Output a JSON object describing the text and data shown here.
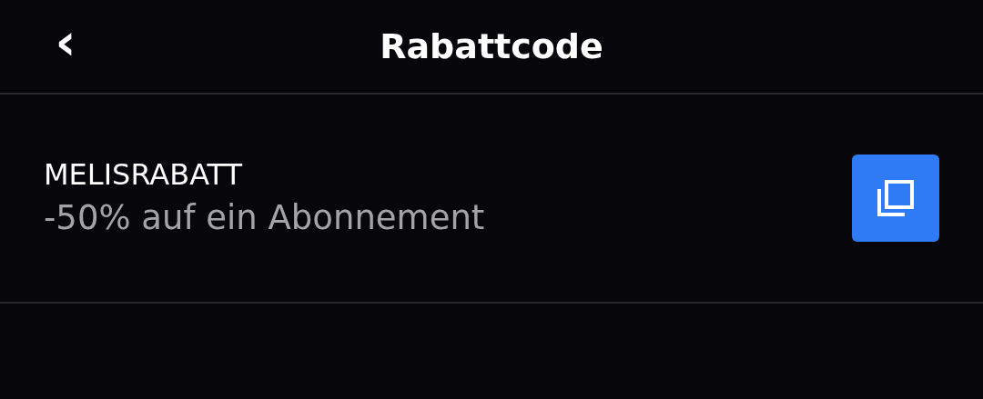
{
  "header": {
    "back": "‹",
    "title": "Rabattcode"
  },
  "codes": [
    {
      "code": "MELISRABATT",
      "description": "-50% auf ein Abonnement"
    }
  ]
}
